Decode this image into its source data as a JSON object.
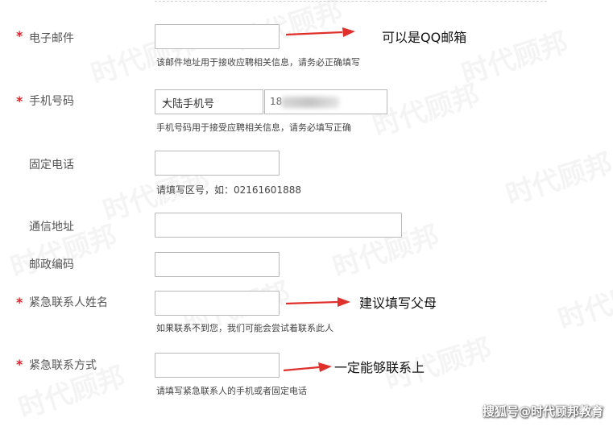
{
  "fields": {
    "email": {
      "label": "电子邮件",
      "required": true,
      "hint": "该邮件地址用于接收应聘相关信息，请务必正确填写"
    },
    "mobile": {
      "label": "手机号码",
      "required": true,
      "type_selected": "大陆手机号",
      "value_visible": "18",
      "hint": "手机号码用于接受应聘相关信息，请务必填写正确"
    },
    "landline": {
      "label": "固定电话",
      "required": false,
      "hint": "请填写区号，如：02161601888"
    },
    "address": {
      "label": "通信地址",
      "required": false
    },
    "postal": {
      "label": "邮政编码",
      "required": false
    },
    "emergency_name": {
      "label": "紧急联系人姓名",
      "required": true,
      "hint": "如果联系不到您，我们可能会尝试着联系此人"
    },
    "emergency_contact": {
      "label": "紧急联系方式",
      "required": true,
      "hint": "请填写紧急联系人的手机或者固定电话"
    }
  },
  "annotations": {
    "email_note": "可以是QQ邮箱",
    "emergency_name_note": "建议填写父母",
    "emergency_contact_note": "一定能够联系上"
  },
  "watermark": {
    "text": "时代顾邦"
  },
  "footer": {
    "text": "搜狐号@时代顾邦教育"
  },
  "colors": {
    "required_star": "#d9262c",
    "arrow": "#e0302c"
  }
}
